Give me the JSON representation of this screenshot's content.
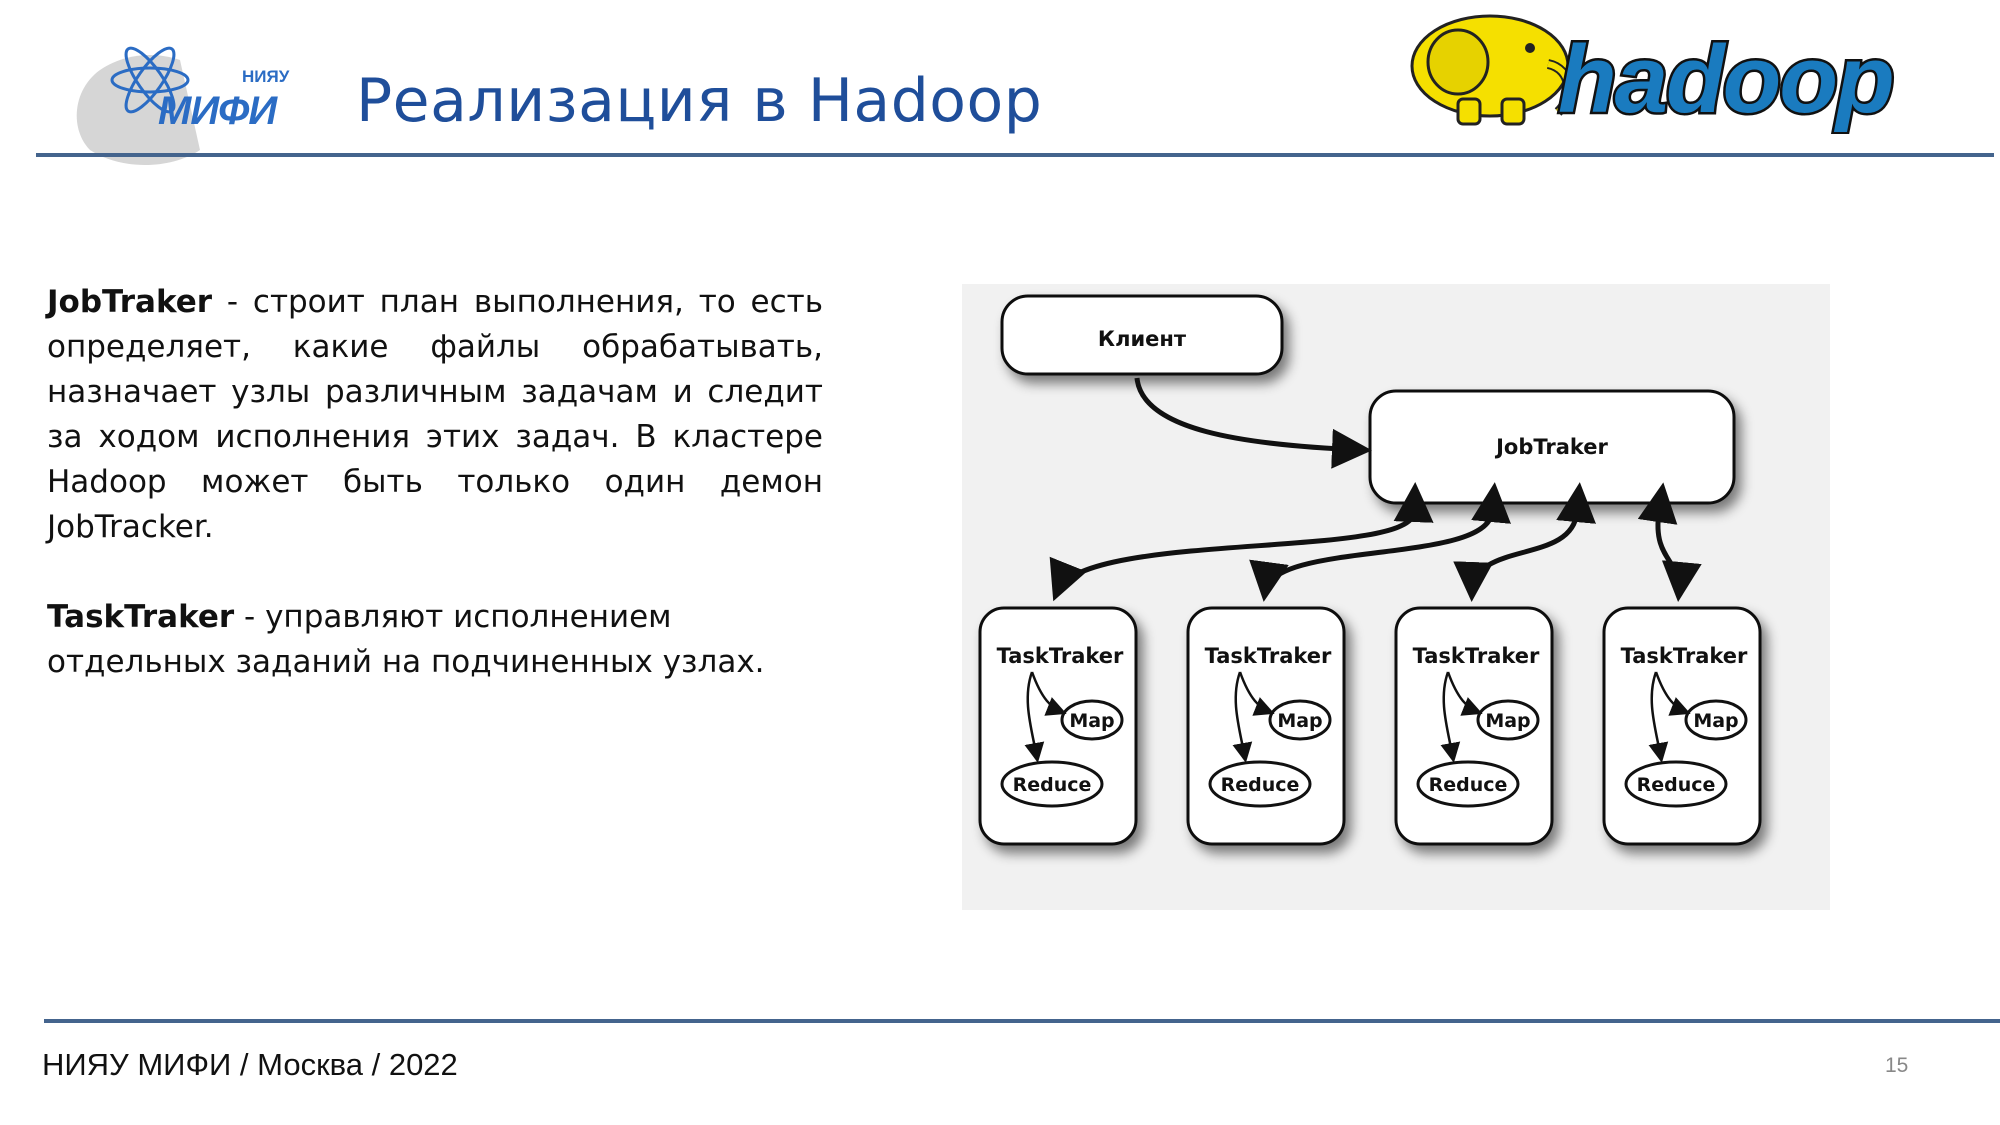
{
  "header": {
    "logo_small_text": "НИЯУ",
    "logo_main_text": "МИФИ",
    "title": "Реализация в Hadoop",
    "hadoop_logo_text": "hadoop"
  },
  "content": {
    "jobtracker": {
      "term": "JobTraker",
      "definition": " - строит план выполнения, то есть определяет, какие файлы обрабатывать, назначает узлы различным задачам и следит за ходом исполнения этих задач. В кластере Hadoop может быть только один демон JobTracker."
    },
    "tasktracker": {
      "term": "TaskTraker",
      "definition": " - управляют исполнением отдельных заданий на подчиненных узлах."
    }
  },
  "diagram": {
    "client_label": "Клиент",
    "jobtracker_label": "JobTraker",
    "tasktracker_label": "TaskTraker",
    "map_label": "Map",
    "reduce_label": "Reduce"
  },
  "footer": {
    "text": "НИЯУ МИФИ / Москва / 2022",
    "page_number": "15"
  },
  "colors": {
    "title": "#1f4e9a",
    "rule": "#44648d",
    "hadoop_yellow": "#f5e000",
    "hadoop_blue": "#1a7bbf"
  }
}
